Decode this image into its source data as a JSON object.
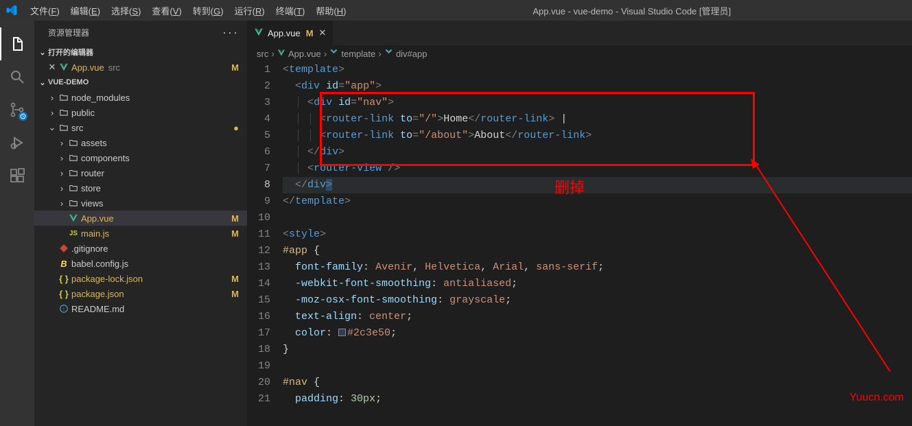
{
  "title_bar": {
    "menu": [
      {
        "label": "文件",
        "mn": "F"
      },
      {
        "label": "编辑",
        "mn": "E"
      },
      {
        "label": "选择",
        "mn": "S"
      },
      {
        "label": "查看",
        "mn": "V"
      },
      {
        "label": "转到",
        "mn": "G"
      },
      {
        "label": "运行",
        "mn": "R"
      },
      {
        "label": "终端",
        "mn": "T"
      },
      {
        "label": "帮助",
        "mn": "H"
      }
    ],
    "title": "App.vue - vue-demo - Visual Studio Code [管理员]"
  },
  "sidebar": {
    "title": "资源管理器",
    "sections": {
      "open_editors": {
        "label": "打开的编辑器",
        "items": [
          {
            "icon": "vue",
            "name": "App.vue",
            "dir": "src",
            "status": "M"
          }
        ]
      },
      "project": {
        "label": "VUE-DEMO",
        "tree": [
          {
            "indent": 1,
            "chev": ">",
            "icon": "folder",
            "name": "node_modules"
          },
          {
            "indent": 1,
            "chev": ">",
            "icon": "folder",
            "name": "public"
          },
          {
            "indent": 1,
            "chev": "v",
            "icon": "folder",
            "name": "src",
            "status_dot": true
          },
          {
            "indent": 2,
            "chev": ">",
            "icon": "folder",
            "name": "assets"
          },
          {
            "indent": 2,
            "chev": ">",
            "icon": "folder",
            "name": "components"
          },
          {
            "indent": 2,
            "chev": ">",
            "icon": "folder",
            "name": "router"
          },
          {
            "indent": 2,
            "chev": ">",
            "icon": "folder",
            "name": "store"
          },
          {
            "indent": 2,
            "chev": ">",
            "icon": "folder",
            "name": "views"
          },
          {
            "indent": 2,
            "icon": "vue",
            "name": "App.vue",
            "status": "M",
            "selected": true,
            "git_mod": true
          },
          {
            "indent": 2,
            "icon": "js",
            "name": "main.js",
            "status": "M",
            "git_mod": true
          },
          {
            "indent": 1,
            "icon": "git",
            "name": ".gitignore"
          },
          {
            "indent": 1,
            "icon": "babel",
            "name": "babel.config.js"
          },
          {
            "indent": 1,
            "icon": "json",
            "name": "package-lock.json",
            "status": "M",
            "git_mod": true
          },
          {
            "indent": 1,
            "icon": "json",
            "name": "package.json",
            "status": "M",
            "git_mod": true
          },
          {
            "indent": 1,
            "icon": "readme",
            "name": "README.md"
          }
        ]
      }
    }
  },
  "editor": {
    "tab": {
      "name": "App.vue",
      "status": "M"
    },
    "breadcrumbs": [
      "src",
      "App.vue",
      "template",
      "div#app"
    ],
    "color_hex": "#2c3e50",
    "lines_count": 21
  },
  "annotation": {
    "text": "删掉"
  },
  "watermark": "Yuucn.com"
}
